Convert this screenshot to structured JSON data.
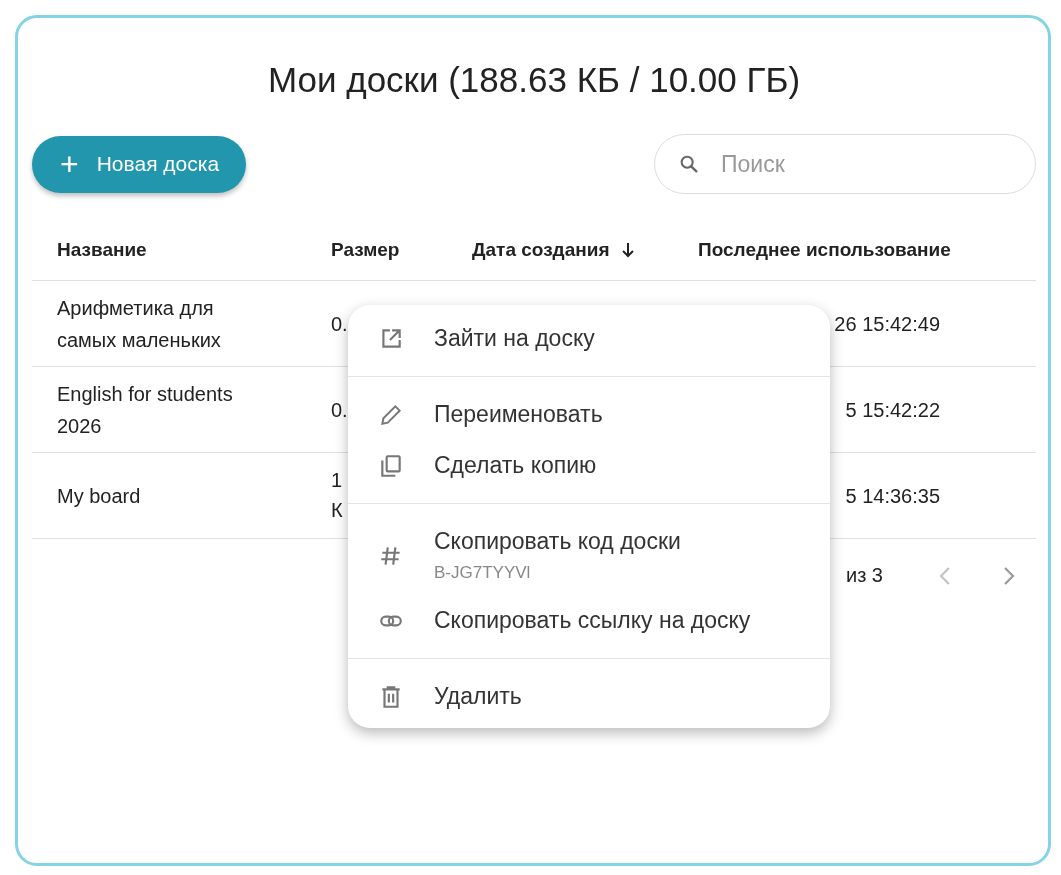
{
  "title": "Мои доски (188.63 КБ / 10.00 ГБ)",
  "new_button": {
    "icon": "+",
    "label": "Новая доска"
  },
  "search": {
    "placeholder": "Поиск"
  },
  "table": {
    "columns": [
      {
        "label": "Название",
        "sorted": false
      },
      {
        "label": "Размер",
        "sorted": false
      },
      {
        "label": "Дата создания",
        "sorted": true
      },
      {
        "label": "Последнее использование",
        "sorted": false
      }
    ],
    "rows": [
      {
        "name": "Арифметика для самых маленьких",
        "size": "0.",
        "last_used": "26 15:42:49"
      },
      {
        "name": "English for students 2026",
        "size": "0.",
        "last_used": "5 15:42:22"
      },
      {
        "name": "My board",
        "size": "1 К",
        "last_used": "5 14:36:35"
      }
    ]
  },
  "pagination": {
    "range": "из 3",
    "prev_disabled": true,
    "next_disabled": false
  },
  "context_menu": {
    "groups": [
      [
        {
          "kind": "open",
          "label": "Зайти на доску"
        }
      ],
      [
        {
          "kind": "rename",
          "label": "Переименовать"
        },
        {
          "kind": "copy",
          "label": "Сделать копию"
        }
      ],
      [
        {
          "kind": "code",
          "label": "Скопировать код доски",
          "sub": "B-JG7TYYVl"
        },
        {
          "kind": "link",
          "label": "Скопировать ссылку на доску"
        }
      ],
      [
        {
          "kind": "delete",
          "label": "Удалить"
        }
      ]
    ]
  }
}
